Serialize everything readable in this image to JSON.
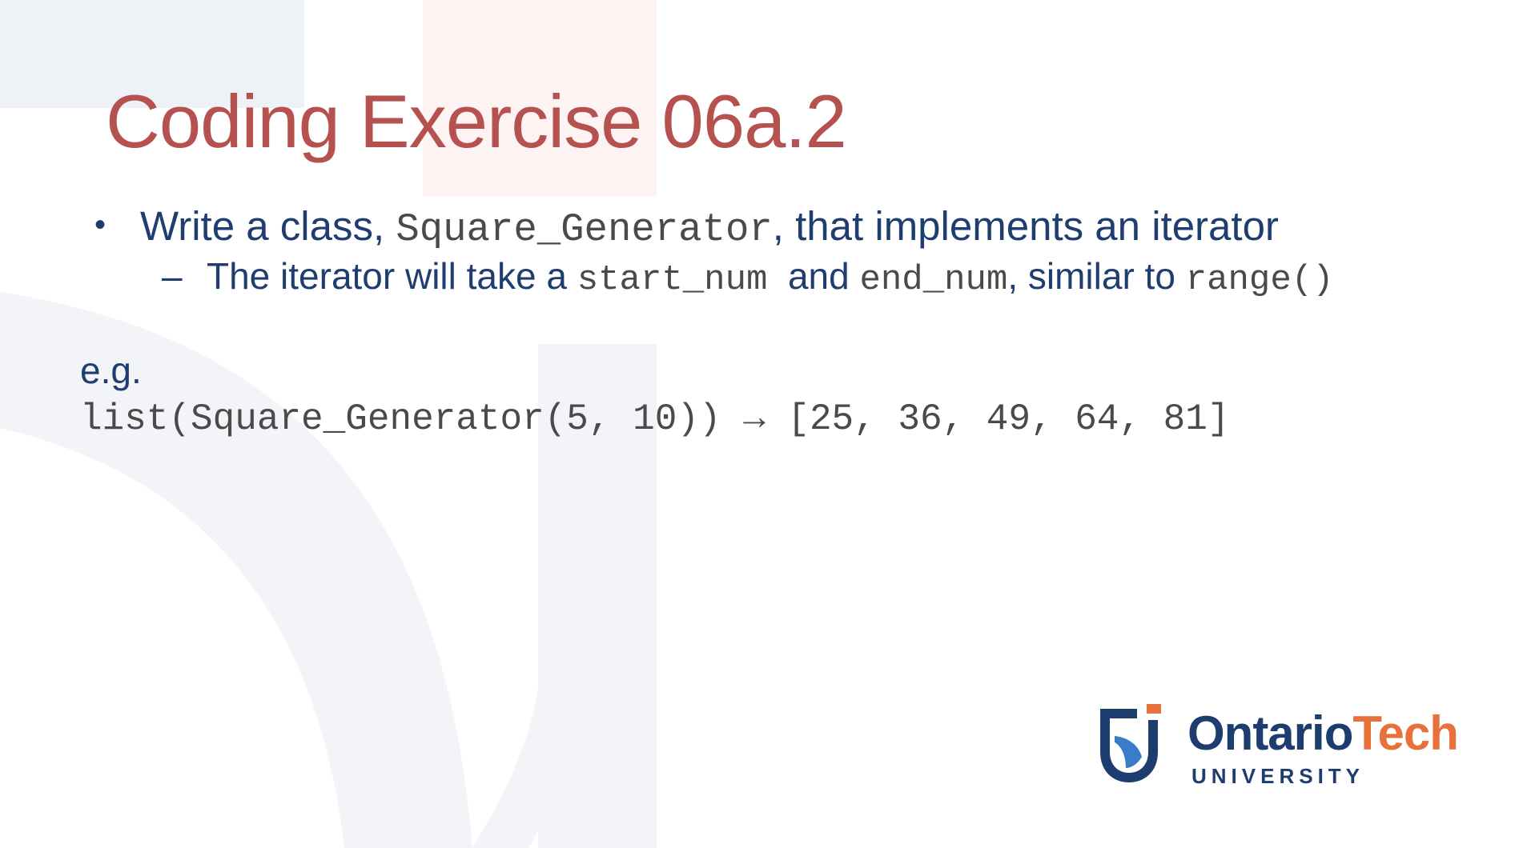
{
  "slide": {
    "title": "Coding Exercise 06a.2",
    "bullet1": {
      "marker": "•",
      "text_before": "Write a class, ",
      "code": "Square_Generator",
      "text_after": ", that implements an iterator"
    },
    "bullet2": {
      "marker": "–",
      "text_before": "The iterator will take a ",
      "code1": "start_num",
      "text_mid": "  and ",
      "code2": "end_num",
      "text_mid2": ", similar to ",
      "code3": "range()"
    },
    "example_label": "e.g.",
    "example_code": "list(Square_Generator(5, 10)) → [25, 36, 49, 64, 81]"
  },
  "logo": {
    "name_part1": "Ontario",
    "name_part2": "Tech",
    "subtitle": "UNIVERSITY"
  },
  "colors": {
    "title": "#b5524f",
    "body_text": "#1f3d6e",
    "code_text": "#4a4a4a",
    "logo_navy": "#1d3d6e",
    "logo_orange": "#e8703a",
    "logo_blue": "#3a7cc9"
  }
}
